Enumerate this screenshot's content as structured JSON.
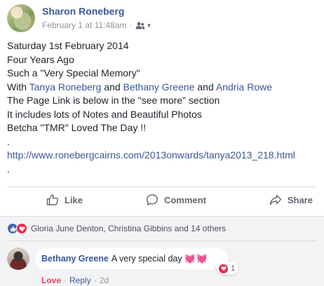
{
  "post": {
    "author": "Sharon Roneberg",
    "timestamp": "February 1 at 11:48am",
    "separator": "·",
    "audience_icon": "friends-icon",
    "lines": {
      "l1": "Saturday 1st February 2014",
      "l2": "Four Years Ago",
      "l3": "Such a \"Very Special Memory\"",
      "l4_prefix": "With ",
      "l4_tag1": "Tanya Roneberg",
      "l4_and1": " and ",
      "l4_tag2": "Bethany Greene",
      "l4_and2": " and ",
      "l4_tag3": "Andria Rowe",
      "l5": "The Page Link is below in the \"see more\" section",
      "l6": "It includes lots of Notes and Beautiful Photos",
      "l7": "Betcha \"TMR\" Loved The Day !!",
      "l8": ".",
      "url": "http://www.ronebergcairns.com/2013onwards/tanya2013_218.html",
      "l10": "."
    }
  },
  "actions": {
    "like": "Like",
    "comment": "Comment",
    "share": "Share"
  },
  "reactions": {
    "summary": "Gloria June Denton, Christina Gibbins and 14 others",
    "like_color": "#4267b2",
    "love_color": "#f0284a"
  },
  "comment": {
    "author": "Bethany Greene",
    "text": "A very special day",
    "emoji": "💓💓",
    "reaction_count": "1",
    "love_label": "Love",
    "dot": "·",
    "reply_label": "Reply",
    "time": "2d"
  },
  "colors": {
    "link": "#385898",
    "text": "#1d2129",
    "muted": "#90949c",
    "feedback_bg": "#f2f3f5"
  }
}
